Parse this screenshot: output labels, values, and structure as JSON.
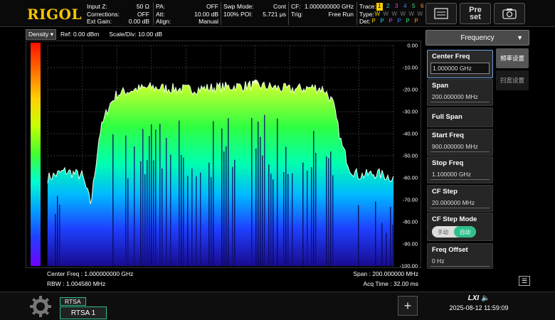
{
  "brand": "RIGOL",
  "status": {
    "input_z_label": "Input Z:",
    "input_z": "50 Ω",
    "corrections_label": "Corrections:",
    "corrections": "OFF",
    "ext_gain_label": "Ext Gain:",
    "ext_gain": "0.00 dB",
    "pa_label": "PA:",
    "pa": "OFF",
    "att_label": "Att:",
    "att": "10.00 dB",
    "align_label": "Align:",
    "align": "Manual",
    "swp_mode_label": "Swp Mode:",
    "swp_mode": "Cont",
    "poi": "100% POI:",
    "poi_time": "5.721 μs",
    "cf_label": "CF:",
    "cf": "1.000000000 GHz",
    "trig_label": "Trig:",
    "trig": "Free Run",
    "trace_label": "Trace:",
    "type_label": "Type:",
    "det_label": "Det:",
    "traces": [
      "1",
      "2",
      "3",
      "4",
      "5",
      "6"
    ],
    "types": [
      "W",
      "W",
      "W",
      "W",
      "W",
      "W"
    ],
    "dets": [
      "P",
      "P",
      "P",
      "P",
      "P",
      "P"
    ]
  },
  "toolbar": {
    "preset_line1": "Pre",
    "preset_line2": "set"
  },
  "display": {
    "mode": "Density",
    "ref": "Ref: 0.00 dBm",
    "scale": "Scale/Div: 10.00 dB"
  },
  "y_ticks": [
    "0.00",
    "-10.00",
    "-20.00",
    "-30.00",
    "-40.00",
    "-50.00",
    "-60.00",
    "-70.00",
    "-80.00",
    "-90.00",
    "-100.00"
  ],
  "footer": {
    "center_freq": "Center Freq : 1.000000000 GHz",
    "rbw": "RBW : 1.004580 MHz",
    "span": "Span : 200.000000 MHz",
    "acq_time": "Acq Time : 32.00 ms"
  },
  "menu": {
    "title": "Frequency",
    "tabs": [
      "频率设置",
      "扫宽设置"
    ],
    "center_freq": {
      "label": "Center Freq",
      "value": "1.000000 GHz"
    },
    "span": {
      "label": "Span",
      "value": "200.000000 MHz"
    },
    "full_span": {
      "label": "Full Span"
    },
    "start_freq": {
      "label": "Start Freq",
      "value": "900.000000 MHz"
    },
    "stop_freq": {
      "label": "Stop Freq",
      "value": "1.100000 GHz"
    },
    "cf_step": {
      "label": "CF Step",
      "value": "20.000000 MHz"
    },
    "cf_step_mode": {
      "label": "CF Step Mode",
      "opt_manual": "手动",
      "opt_auto": "自动"
    },
    "freq_offset": {
      "label": "Freq Offset",
      "value": "0 Hz"
    }
  },
  "bottom": {
    "tab_tag": "RTSA",
    "tab_label": "RTSA 1",
    "add": "+",
    "datetime": "2025-08-12 11:59:09",
    "lxi": "LXI"
  },
  "chart_data": {
    "type": "area",
    "title": "",
    "xlabel": "",
    "ylabel": "",
    "x_unit": "MHz",
    "y_unit": "dBm",
    "xlim": [
      900,
      1100
    ],
    "ylim": [
      -100,
      0
    ],
    "grid": true,
    "series": [
      {
        "x": [
          900,
          910,
          920,
          925,
          930,
          935,
          940,
          950,
          960,
          980,
          1000,
          1020,
          1040,
          1055,
          1060,
          1065,
          1070,
          1075,
          1080,
          1090,
          1100
        ],
        "y": [
          -60,
          -57,
          -59,
          -72,
          -40,
          -28,
          -22,
          -20,
          -19,
          -20,
          -19,
          -18,
          -20,
          -19,
          -20,
          -26,
          -45,
          -56,
          -59,
          -58,
          -60
        ]
      }
    ]
  }
}
